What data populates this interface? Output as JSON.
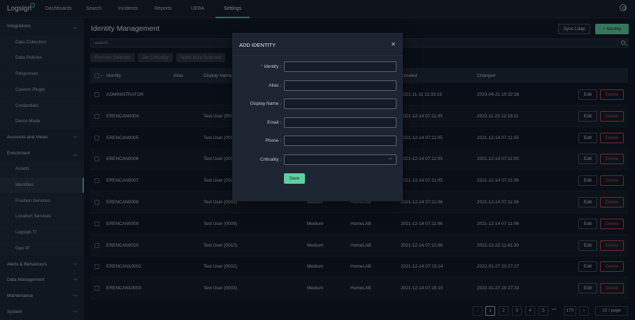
{
  "app": {
    "logo": "Logsign"
  },
  "nav": {
    "items": [
      "Dashboards",
      "Search",
      "Incidents",
      "Reports",
      "UEBA",
      "Settings"
    ],
    "active": "Settings"
  },
  "sidebar": {
    "items": [
      {
        "label": "Integrations",
        "type": "section",
        "chevron": "up"
      },
      {
        "label": "Data Collection",
        "type": "sub"
      },
      {
        "label": "Data Policies",
        "type": "sub"
      },
      {
        "label": "Responses",
        "type": "sub"
      },
      {
        "label": "Custom Plugin",
        "type": "sub"
      },
      {
        "label": "Credentials",
        "type": "sub"
      },
      {
        "label": "Demo Mode",
        "type": "sub"
      },
      {
        "label": "Accounts and Views",
        "type": "section",
        "chevron": "down"
      },
      {
        "label": "Enrichment",
        "type": "section",
        "chevron": "up"
      },
      {
        "label": "Assets",
        "type": "sub"
      },
      {
        "label": "Identities",
        "type": "sub",
        "active": true
      },
      {
        "label": "Position Services",
        "type": "sub"
      },
      {
        "label": "Location Services",
        "type": "sub"
      },
      {
        "label": "Logsign TI",
        "type": "sub"
      },
      {
        "label": "Geo IP",
        "type": "sub"
      },
      {
        "label": "Alerts & Behaviours",
        "type": "section",
        "chevron": "down"
      },
      {
        "label": "Data Management",
        "type": "section",
        "chevron": "down"
      },
      {
        "label": "Maintenance",
        "type": "section",
        "chevron": "down"
      },
      {
        "label": "System",
        "type": "section",
        "chevron": "down"
      }
    ]
  },
  "main": {
    "title": "Identity Management",
    "sync_label": "Sync Ldap",
    "add_label": "Identity",
    "search_placeholder": "search",
    "bulk": {
      "remove": "Remove Selected",
      "criticality": "Set Criticality",
      "apply": "Apply Note Selected"
    }
  },
  "table": {
    "headers": {
      "identity": "Identity",
      "alias": "Alias",
      "display_name": "Display Name",
      "created": "Created",
      "changed": "Changed"
    },
    "edit_label": "Edit",
    "delete_label": "Delete",
    "rows": [
      {
        "identity": "ADMINISTRATOR",
        "display_name": "",
        "criticality": "",
        "group": "",
        "created": "2021-11-11 11:33:19",
        "changed": "2023-04-21 10:32:36"
      },
      {
        "identity": "ERENCAN0004",
        "display_name": "Test User (000",
        "criticality": "",
        "group": "",
        "created": "2021-12-14 07:11:05",
        "changed": "2022-11-23 12:18:11"
      },
      {
        "identity": "ERENCAN0005",
        "display_name": "Test User (000",
        "criticality": "",
        "group": "",
        "created": "2021-12-14 07:11:05",
        "changed": "2021-12-14 07:11:05"
      },
      {
        "identity": "ERENCAN0006",
        "display_name": "Test User (000",
        "criticality": "",
        "group": "",
        "created": "2021-12-14 07:11:05",
        "changed": "2021-12-14 07:11:05"
      },
      {
        "identity": "ERENCAN0007",
        "display_name": "Test User (000",
        "criticality": "",
        "group": "",
        "created": "2021-12-14 07:11:05",
        "changed": "2021-12-14 07:11:06"
      },
      {
        "identity": "ERENCAN0008",
        "display_name": "Test User (0008)",
        "criticality": "Medium",
        "group": "HomeLAB",
        "created": "2021-12-14 07:11:06",
        "changed": "2021-12-14 07:11:06"
      },
      {
        "identity": "ERENCAN0009",
        "display_name": "Test User (0009)",
        "criticality": "Medium",
        "group": "HomeLAB",
        "created": "2021-12-14 07:11:06",
        "changed": "2021-12-14 07:11:06"
      },
      {
        "identity": "ERENCAN0010",
        "display_name": "Test User (0010)",
        "criticality": "Medium",
        "group": "HomeLAB",
        "created": "2021-12-14 07:11:06",
        "changed": "2021-12-22 11:41:30"
      },
      {
        "identity": "ERENCAN10002",
        "display_name": "Test User (0002)",
        "criticality": "Medium",
        "group": "HomeLAB",
        "created": "2021-12-14 07:15:14",
        "changed": "2022-01-27 20:27:27"
      },
      {
        "identity": "ERENCAN10003",
        "display_name": "Test User (0003)",
        "criticality": "Medium",
        "group": "HomeLAB",
        "created": "2021-12-14 07:15:15",
        "changed": "2022-01-27 20:27:32"
      }
    ]
  },
  "pagination": {
    "pages": [
      "1",
      "2",
      "3",
      "4",
      "5"
    ],
    "dots": "•••",
    "last": "170",
    "current": "1",
    "per_page": "10 / page"
  },
  "modal": {
    "title": "ADD IDENTITY",
    "fields": [
      {
        "label": "Identity",
        "required": true,
        "type": "input"
      },
      {
        "label": "Alias",
        "required": false,
        "type": "input"
      },
      {
        "label": "Display Name",
        "required": false,
        "type": "input"
      },
      {
        "label": "Email",
        "required": false,
        "type": "input"
      },
      {
        "label": "Phone",
        "required": false,
        "type": "input"
      },
      {
        "label": "Criticality",
        "required": false,
        "type": "select"
      }
    ],
    "save_label": "Save"
  },
  "colors": {
    "accent": "#3ec6a8",
    "primary_button": "#5fcf9f",
    "danger": "#d04646",
    "background": "#10151f"
  }
}
